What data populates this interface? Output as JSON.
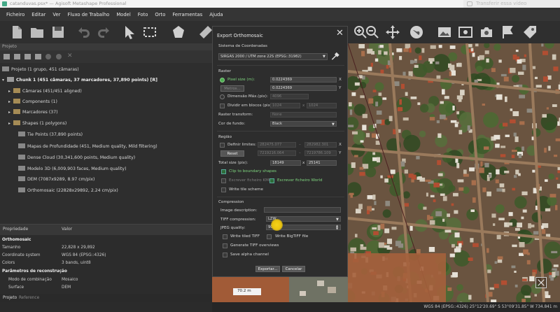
{
  "window": {
    "title": "catanduvas.psx* — Agisoft Metashape Professional",
    "overlay_text": "Transferir essa vídeo"
  },
  "menu": [
    "Ficheiro",
    "Editar",
    "Ver",
    "Fluxo de Trabalho",
    "Model",
    "Foto",
    "Orto",
    "Ferramentas",
    "Ajuda"
  ],
  "toolbar": {
    "icons": [
      "new-file-icon",
      "open-folder-icon",
      "save-icon",
      "undo-icon",
      "redo-icon",
      "pointer-icon",
      "rect-select-icon",
      "polygon-icon",
      "ruler-icon",
      "zoom-in-icon",
      "zoom-out-icon",
      "move-icon",
      "globe-icon",
      "image-icon",
      "photo-icon",
      "camera-icon",
      "flag-icon",
      "tag-icon"
    ]
  },
  "project_panel": {
    "header": "Projeto",
    "tree": [
      {
        "label": "Projeto (1 grupo, 451 câmaras)",
        "icon": "project-icon",
        "indent": 0
      },
      {
        "label": "Chunk 1 (451 câmaras, 37 marcadores, 37,890 points) [R]",
        "icon": "chunk-icon",
        "indent": 1
      },
      {
        "label": "Câmaras (451/451 aligned)",
        "icon": "folder-icon",
        "indent": 2
      },
      {
        "label": "Components (1)",
        "icon": "folder-icon",
        "indent": 2
      },
      {
        "label": "Marcadores (37)",
        "icon": "folder-icon",
        "indent": 2
      },
      {
        "label": "Shapes (1 polygons)",
        "icon": "folder-icon",
        "indent": 2
      },
      {
        "label": "Tie Points (37,890 points)",
        "icon": "tiepoints-icon",
        "indent": 3
      },
      {
        "label": "Mapas de Profundidade (451, Medium quality, Mild filtering)",
        "icon": "depthmap-icon",
        "indent": 3
      },
      {
        "label": "Dense Cloud (30,341,600 points, Medium quality)",
        "icon": "densecloud-icon",
        "indent": 3
      },
      {
        "label": "Modelo 3D (6,009,903 faces, Medium quality)",
        "icon": "model-icon",
        "indent": 3
      },
      {
        "label": "DEM (7087x9289, 8.97 cm/pix)",
        "icon": "dem-icon",
        "indent": 3
      },
      {
        "label": "Orthomosaic (22828x29892, 2.24 cm/pix)",
        "icon": "ortho-icon",
        "indent": 3
      }
    ]
  },
  "properties": {
    "col_prop": "Propriedade",
    "col_val": "Valor",
    "section1": "Orthomosaic",
    "rows1": [
      {
        "k": "Tamanho",
        "v": "22,828 x 29,892"
      },
      {
        "k": "Coordinate system",
        "v": "WGS 84 (EPSG::4326)"
      },
      {
        "k": "Colors",
        "v": "3 bands, uint8"
      }
    ],
    "section2": "Parâmetros de reconstrução",
    "rows2": [
      {
        "k": "Modo de combinação",
        "v": "Mosaico"
      },
      {
        "k": "Surface",
        "v": "DEM"
      }
    ],
    "tabs": [
      "Projeto",
      "Reference"
    ]
  },
  "dialog": {
    "title": "Export Orthomosaic",
    "crs_label": "Sistema de Coordenadas",
    "crs_value": "SIRGAS 2000 / UTM zone 22S (EPSG::31982)",
    "raster_label": "Raster",
    "pixel_size_label": "Pixel size (m):",
    "pixel_x": "0.0224369",
    "pixel_y": "0.0224369",
    "metres_btn": "Metros...",
    "max_dim_label": "Dimensão Máx.(pix):",
    "max_dim_value": "4096",
    "split_label": "Dividir em blocos (pix):",
    "split_x": "1024",
    "split_y": "1024",
    "raster_transform_label": "Raster transform:",
    "raster_transform_value": "None",
    "bg_label": "Cor de fundo:",
    "bg_value": "Black",
    "region_label": "Região",
    "bounds_label": "Definir limites:",
    "bound_x1": "282475.077",
    "bound_x2": "282982.301",
    "bound_y1": "7219216.064",
    "bound_y2": "7219786.109",
    "reset_btn": "Reset",
    "total_size_label": "Total size (pix):",
    "total_w": "18149",
    "total_h": "25141",
    "clip_label": "Clip to boundary shapes",
    "kml_label": "Escrever ficheiro KML",
    "world_label": "Escrever ficheiro World",
    "tile_label": "Write tile scheme",
    "compression_label": "Compression",
    "img_desc_label": "Image description:",
    "tiff_comp_label": "TIFF compression:",
    "tiff_comp_value": "LZW",
    "jpeg_label": "JPEG quality:",
    "jpeg_value": "90",
    "tiled_label": "Write tiled TIFF",
    "bigtiff_label": "Write BigTIFF file",
    "overviews_label": "Generate TIFF overviews",
    "alpha_label": "Save alpha channel",
    "export_btn": "Exportar...",
    "cancel_btn": "Cancelar",
    "axis_x": "X",
    "axis_y": "Y",
    "by": "x",
    "dash": "–"
  },
  "map": {
    "scale": "70.2 m"
  },
  "status": {
    "text": "WGS 84 (EPSG::4326)   25°12'20.69\" S  53°09'31.85\" W  734.841 m"
  }
}
